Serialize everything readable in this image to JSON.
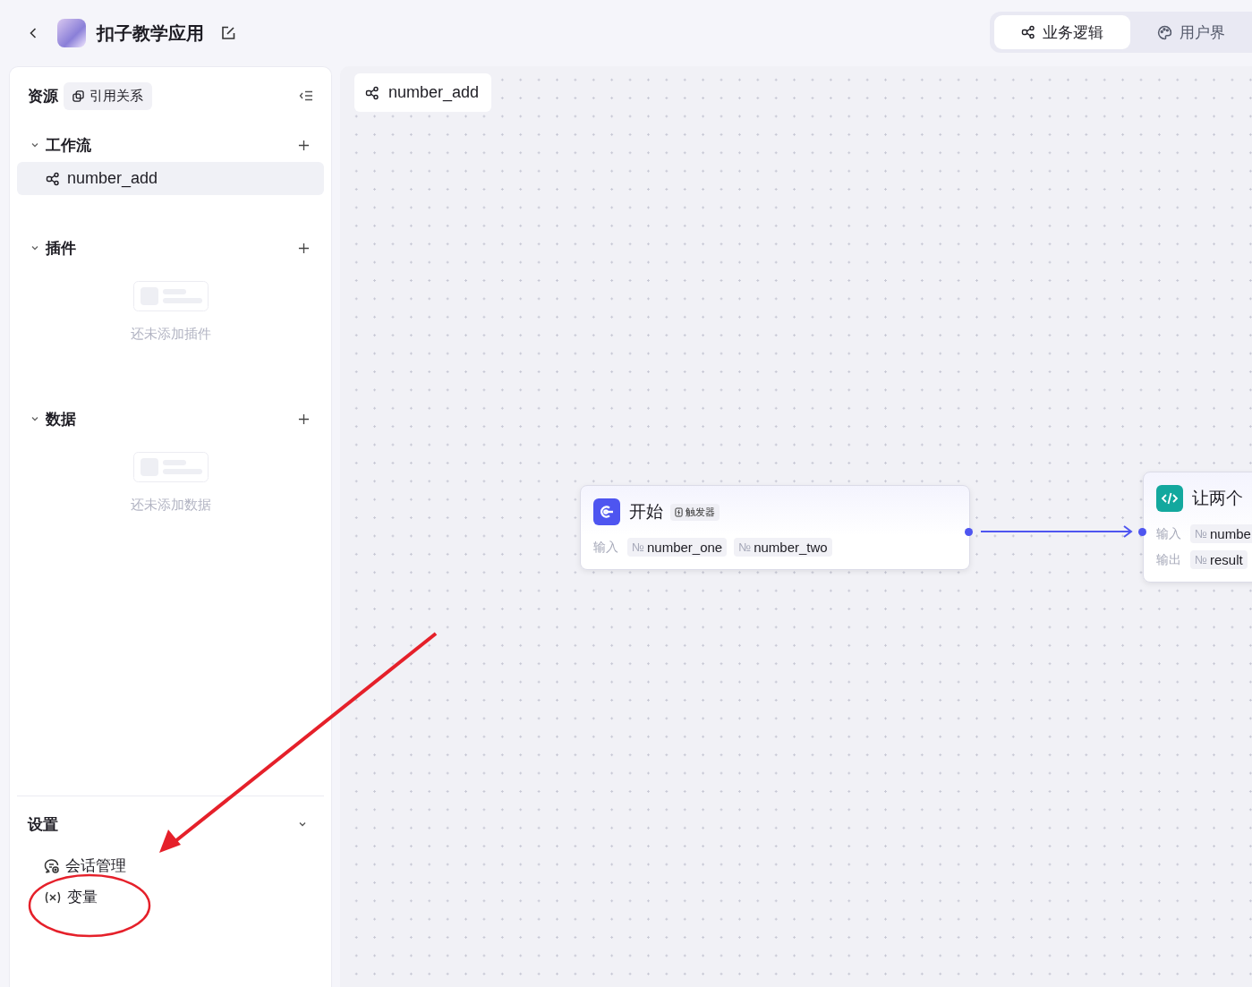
{
  "header": {
    "app_title": "扣子教学应用",
    "tabs": [
      {
        "label": "业务逻辑",
        "selected": true
      },
      {
        "label": "用户界",
        "selected": false
      }
    ]
  },
  "sidebar": {
    "title": "资源",
    "ref_button": "引用关系",
    "sections": [
      {
        "title": "工作流",
        "expanded": true,
        "items": [
          {
            "label": "number_add",
            "selected": true
          }
        ]
      },
      {
        "title": "插件",
        "expanded": true,
        "empty_text": "还未添加插件"
      },
      {
        "title": "数据",
        "expanded": true,
        "empty_text": "还未添加数据"
      }
    ],
    "settings": {
      "title": "设置",
      "expanded": true,
      "items": [
        {
          "label": "会话管理"
        },
        {
          "label": "变量"
        }
      ]
    }
  },
  "canvas": {
    "tab_title": "number_add",
    "nodes": [
      {
        "kind": "start",
        "title": "开始",
        "badge": "触发器",
        "rows": [
          {
            "label": "输入",
            "params": [
              {
                "type_icon": "№",
                "name": "number_one"
              },
              {
                "type_icon": "№",
                "name": "number_two"
              }
            ]
          }
        ]
      },
      {
        "kind": "code",
        "title": "让两个",
        "rows": [
          {
            "label": "输入",
            "params": [
              {
                "type_icon": "№",
                "name": "numbe"
              }
            ]
          },
          {
            "label": "输出",
            "params": [
              {
                "type_icon": "№",
                "name": "result"
              }
            ]
          }
        ]
      }
    ]
  }
}
